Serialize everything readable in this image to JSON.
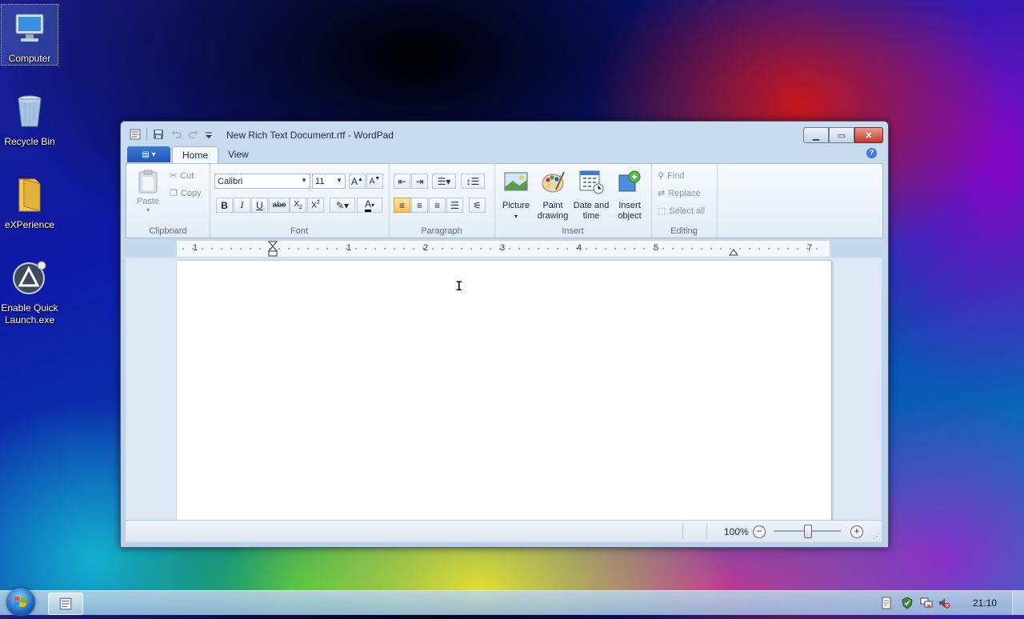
{
  "desktop": {
    "icons": [
      {
        "label": "Computer"
      },
      {
        "label": "Recycle Bin"
      },
      {
        "label": "eXPerience"
      },
      {
        "label": "Enable Quick Launch.exe"
      }
    ]
  },
  "window": {
    "title": "New Rich Text Document.rtf - WordPad",
    "tabs": [
      {
        "label": "Home"
      },
      {
        "label": "View"
      }
    ],
    "clipboard": {
      "group": "Clipboard",
      "paste": "Paste",
      "cut": "Cut",
      "copy": "Copy"
    },
    "font": {
      "group": "Font",
      "family": "Calibri",
      "size": "11"
    },
    "paragraph": {
      "group": "Paragraph"
    },
    "insert": {
      "group": "Insert",
      "picture": "Picture",
      "paint_line1": "Paint",
      "paint_line2": "drawing",
      "datetime_line1": "Date and",
      "datetime_line2": "time",
      "object_line1": "Insert",
      "object_line2": "object"
    },
    "editing": {
      "group": "Editing",
      "find": "Find",
      "replace": "Replace",
      "select_all": "Select all"
    },
    "ruler": [
      "1",
      "1",
      "2",
      "3",
      "4",
      "5",
      "7"
    ],
    "status": {
      "zoom": "100%"
    }
  },
  "taskbar": {
    "clock": "21:10"
  },
  "colors": {
    "accent": "#1e57b5",
    "close": "#c0392b",
    "highlight_btn": "#f8c45a"
  }
}
